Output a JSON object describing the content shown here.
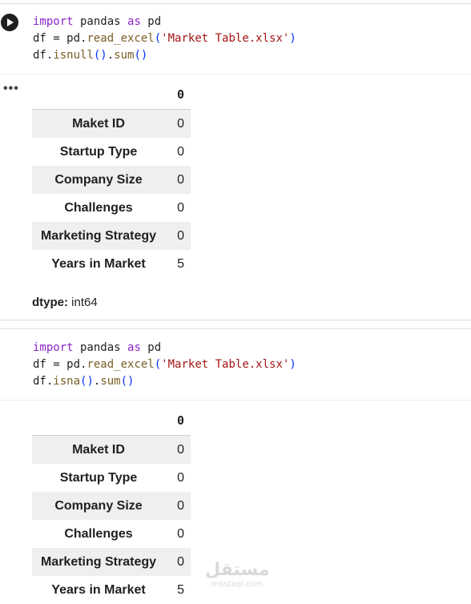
{
  "cell1": {
    "code_line1": {
      "kw1": "import",
      "mod": " pandas ",
      "kw2": "as",
      "alias": " pd"
    },
    "code_line2": {
      "pre": "df = pd.",
      "fn": "read_excel",
      "open": "(",
      "str": "'Market Table.xlsx'",
      "close": ")"
    },
    "code_line3": {
      "pre": "df.",
      "fn1": "isnull",
      "paren1": "()",
      "dot": ".",
      "fn2": "sum",
      "paren2": "()"
    },
    "output": {
      "header": "0",
      "rows": [
        {
          "label": "Maket ID",
          "value": "0"
        },
        {
          "label": "Startup Type",
          "value": "0"
        },
        {
          "label": "Company Size",
          "value": "0"
        },
        {
          "label": "Challenges",
          "value": "0"
        },
        {
          "label": "Marketing Strategy",
          "value": "0"
        },
        {
          "label": "Years in Market",
          "value": "5"
        }
      ],
      "dtype_label": "dtype:",
      "dtype_value": " int64"
    }
  },
  "cell2": {
    "code_line1": {
      "kw1": "import",
      "mod": " pandas ",
      "kw2": "as",
      "alias": " pd"
    },
    "code_line2": {
      "pre": "df = pd.",
      "fn": "read_excel",
      "open": "(",
      "str": "'Market Table.xlsx'",
      "close": ")"
    },
    "code_line3": {
      "pre": "df.",
      "fn1": "isna",
      "paren1": "()",
      "dot": ".",
      "fn2": "sum",
      "paren2": "()"
    },
    "output": {
      "header": "0",
      "rows": [
        {
          "label": "Maket ID",
          "value": "0"
        },
        {
          "label": "Startup Type",
          "value": "0"
        },
        {
          "label": "Company Size",
          "value": "0"
        },
        {
          "label": "Challenges",
          "value": "0"
        },
        {
          "label": "Marketing Strategy",
          "value": "0"
        },
        {
          "label": "Years in Market",
          "value": "5"
        }
      ]
    }
  },
  "output_menu_glyph": "•••",
  "watermark": {
    "arabic": "مستقل",
    "latin": "mostaql.com"
  }
}
